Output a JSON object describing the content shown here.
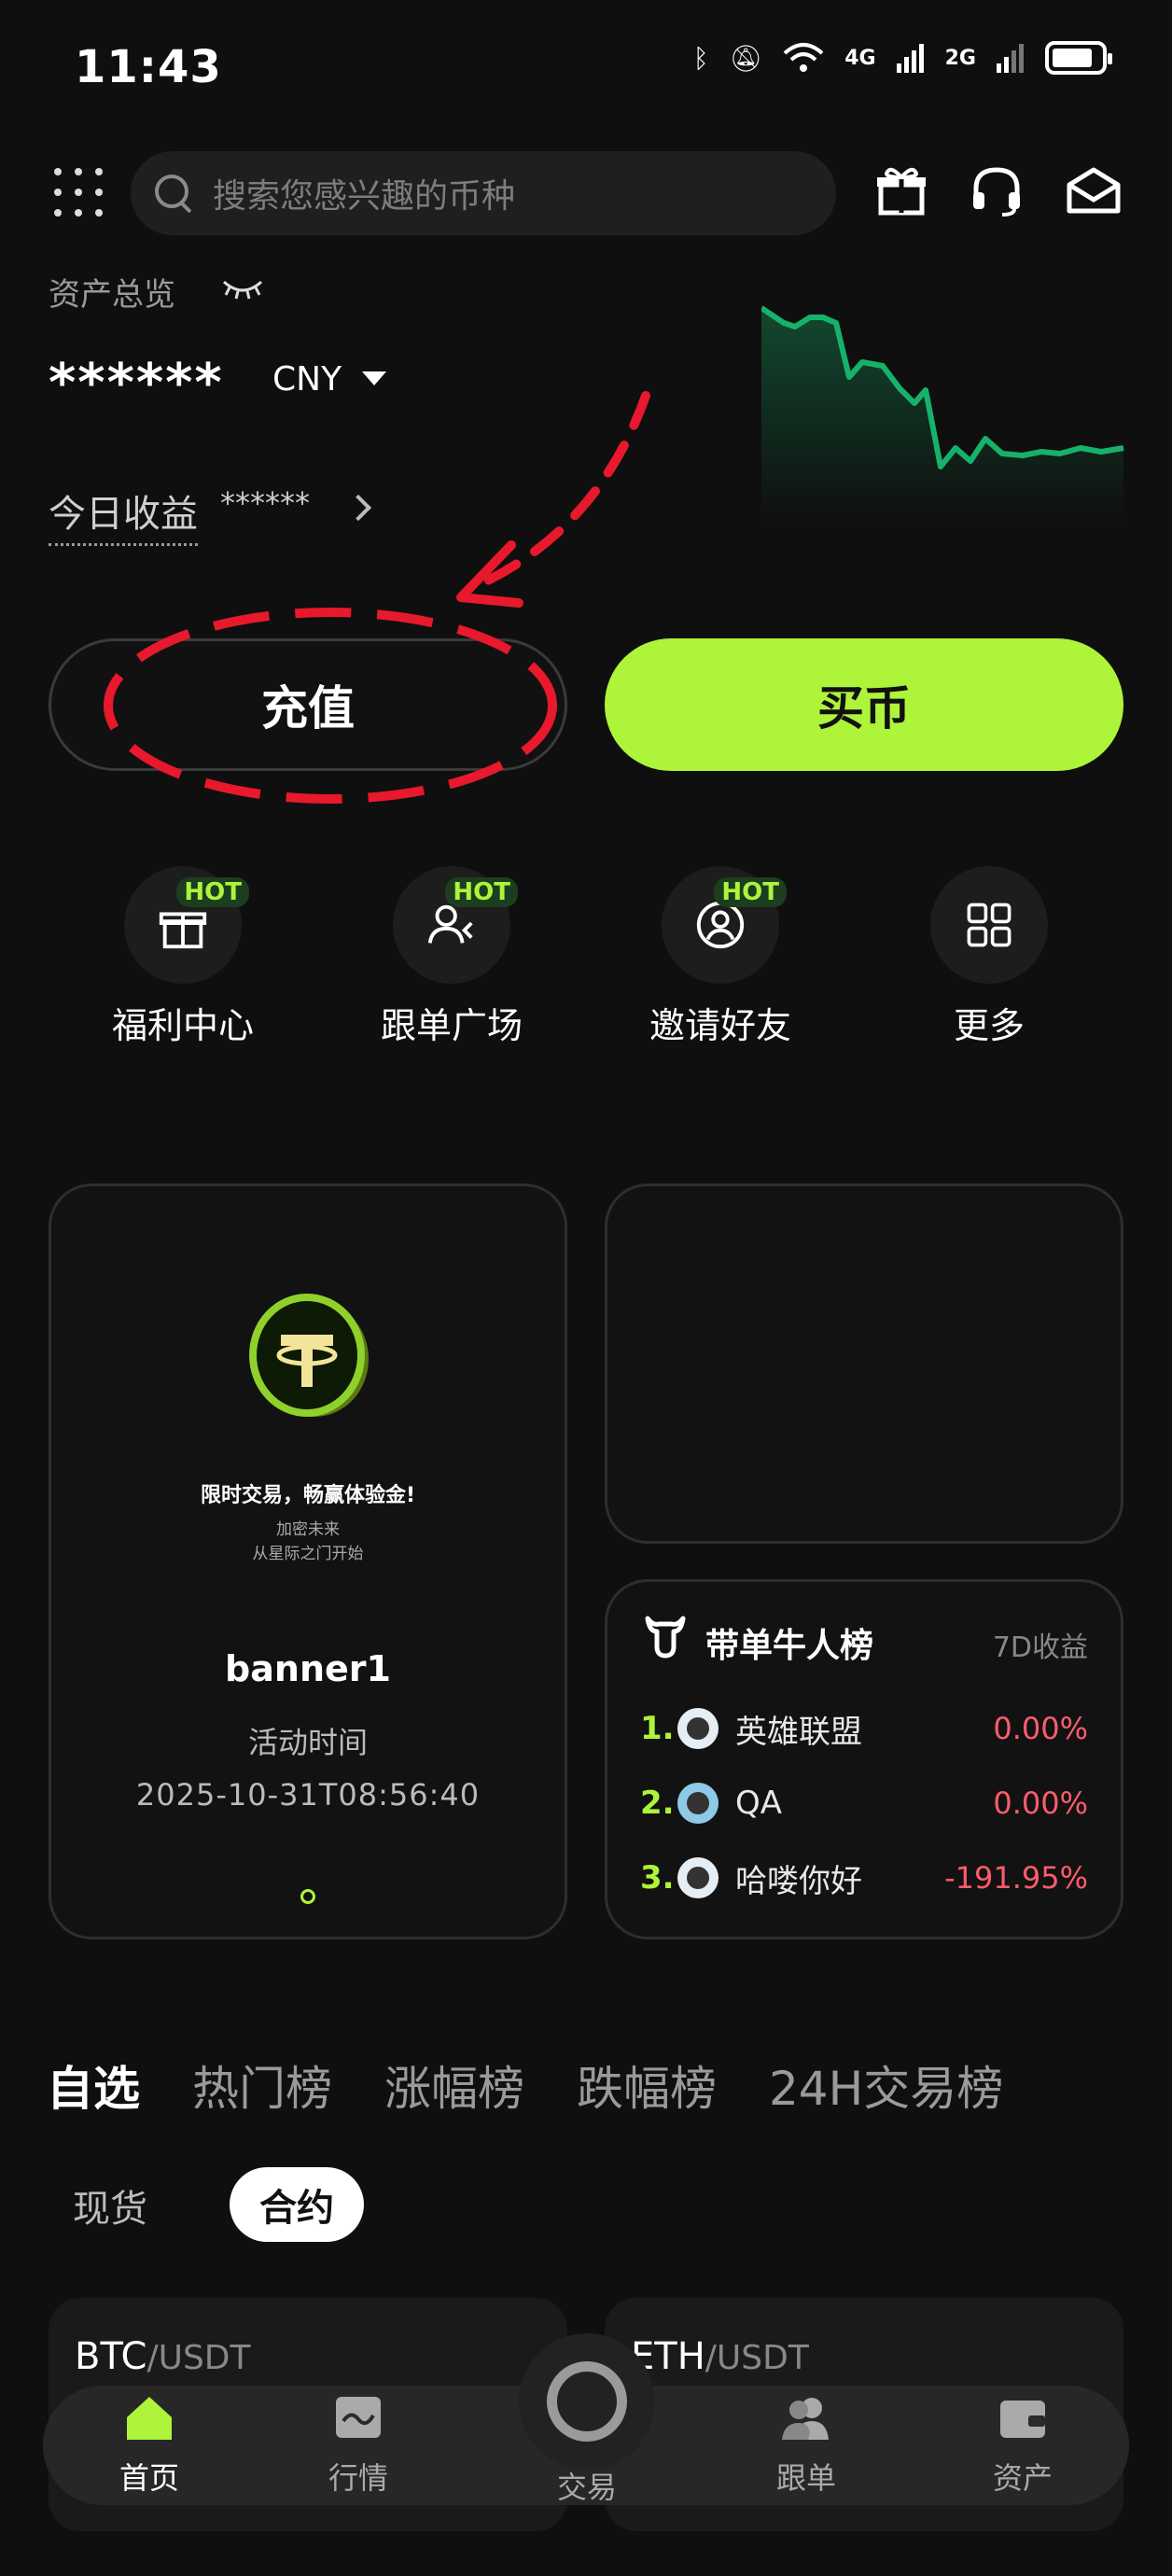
{
  "status_bar": {
    "time": "11:43",
    "net1": "4G",
    "net2": "2G"
  },
  "header": {
    "search_placeholder": "搜索您感兴趣的币种"
  },
  "assets": {
    "label": "资产总览",
    "value_masked": "******",
    "currency": "CNY",
    "pnl_label": "今日收益",
    "pnl_masked": "******"
  },
  "actions": {
    "deposit": "充值",
    "buy": "买币"
  },
  "quick_links": [
    {
      "label": "福利中心",
      "badge": "HOT",
      "icon": "gift-icon"
    },
    {
      "label": "跟单广场",
      "badge": "HOT",
      "icon": "users-icon"
    },
    {
      "label": "邀请好友",
      "badge": "HOT",
      "icon": "user-circle-icon"
    },
    {
      "label": "更多",
      "badge": "",
      "icon": "grid-icon"
    }
  ],
  "banner": {
    "promo_title": "限时交易，畅赢体验金!",
    "promo_sub1": "加密未来",
    "promo_sub2": "从星际之门开始",
    "name": "banner1",
    "time_label": "活动时间",
    "time": "2025-10-31T08:56:40"
  },
  "ranking": {
    "title": "带单牛人榜",
    "period": "7D收益",
    "rows": [
      {
        "rank": "1.",
        "name": "英雄联盟",
        "pct": "0.00%"
      },
      {
        "rank": "2.",
        "name": "QA",
        "pct": "0.00%"
      },
      {
        "rank": "3.",
        "name": "哈喽你好",
        "pct": "-191.95%"
      }
    ]
  },
  "market_tabs": [
    "自选",
    "热门榜",
    "涨幅榜",
    "跌幅榜",
    "24H交易榜"
  ],
  "market_subtabs": {
    "spot": "现货",
    "futures": "合约"
  },
  "market_cards": [
    {
      "base": "BTC",
      "quote": "/USDT"
    },
    {
      "base": "ETH",
      "quote": "/USDT"
    }
  ],
  "bottom_nav": {
    "home": "首页",
    "market": "行情",
    "trade": "交易",
    "copy": "跟单",
    "assets": "资产"
  },
  "colors": {
    "accent": "#adf43a",
    "negative": "#ff5c6c",
    "chart_line": "#17b26a",
    "annotation": "#e8192c"
  }
}
